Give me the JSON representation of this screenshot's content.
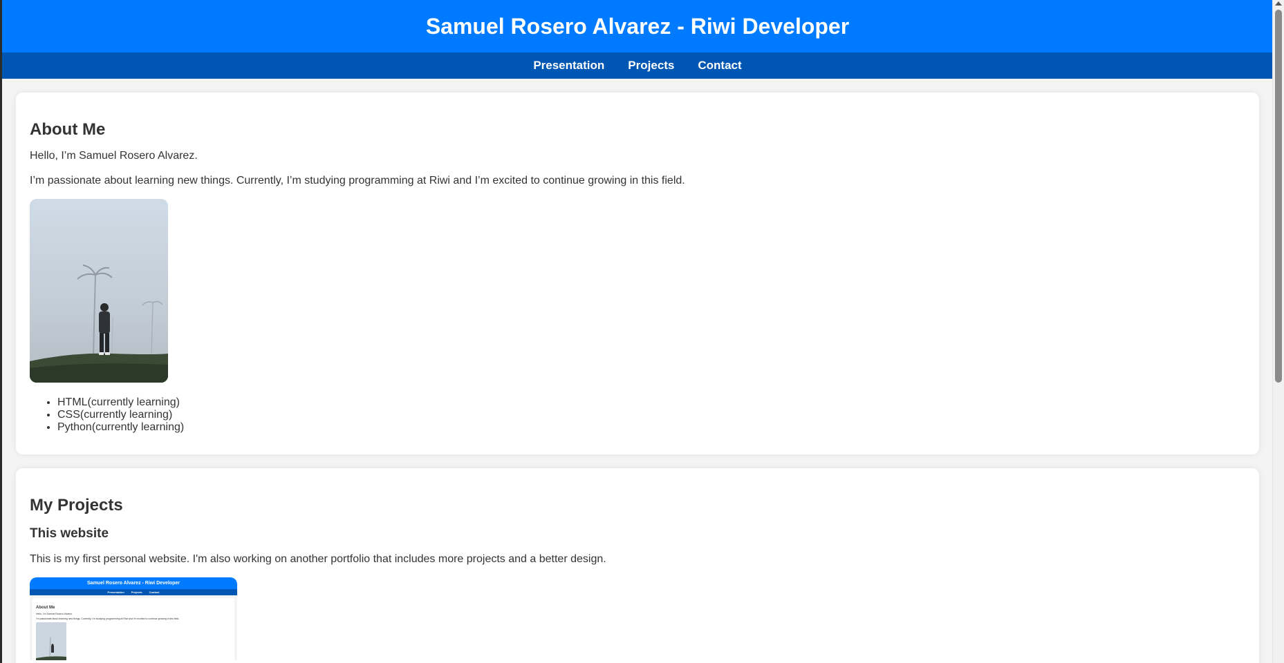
{
  "header": {
    "title": "Samuel Rosero Alvarez - Riwi Developer"
  },
  "nav": {
    "items": [
      "Presentation",
      "Projects",
      "Contact"
    ]
  },
  "about": {
    "heading": "About Me",
    "greeting": "Hello, I’m Samuel Rosero Alvarez.",
    "bio": "I’m passionate about learning new things. Currently, I’m studying programming at Riwi and I’m excited to continue growing in this field.",
    "skills": [
      "HTML(currently learning)",
      "CSS(currently learning)",
      "Python(currently learning)"
    ]
  },
  "projects": {
    "heading": "My Projects",
    "items": [
      {
        "title": "This website",
        "description": "This is my first personal website. I'm also working on another portfolio that includes more projects and a better design."
      }
    ]
  },
  "colors": {
    "header_bg": "#007bff",
    "nav_bg": "#0056b3",
    "page_bg": "#f4f4f4",
    "card_bg": "#ffffff",
    "text": "#333333"
  }
}
